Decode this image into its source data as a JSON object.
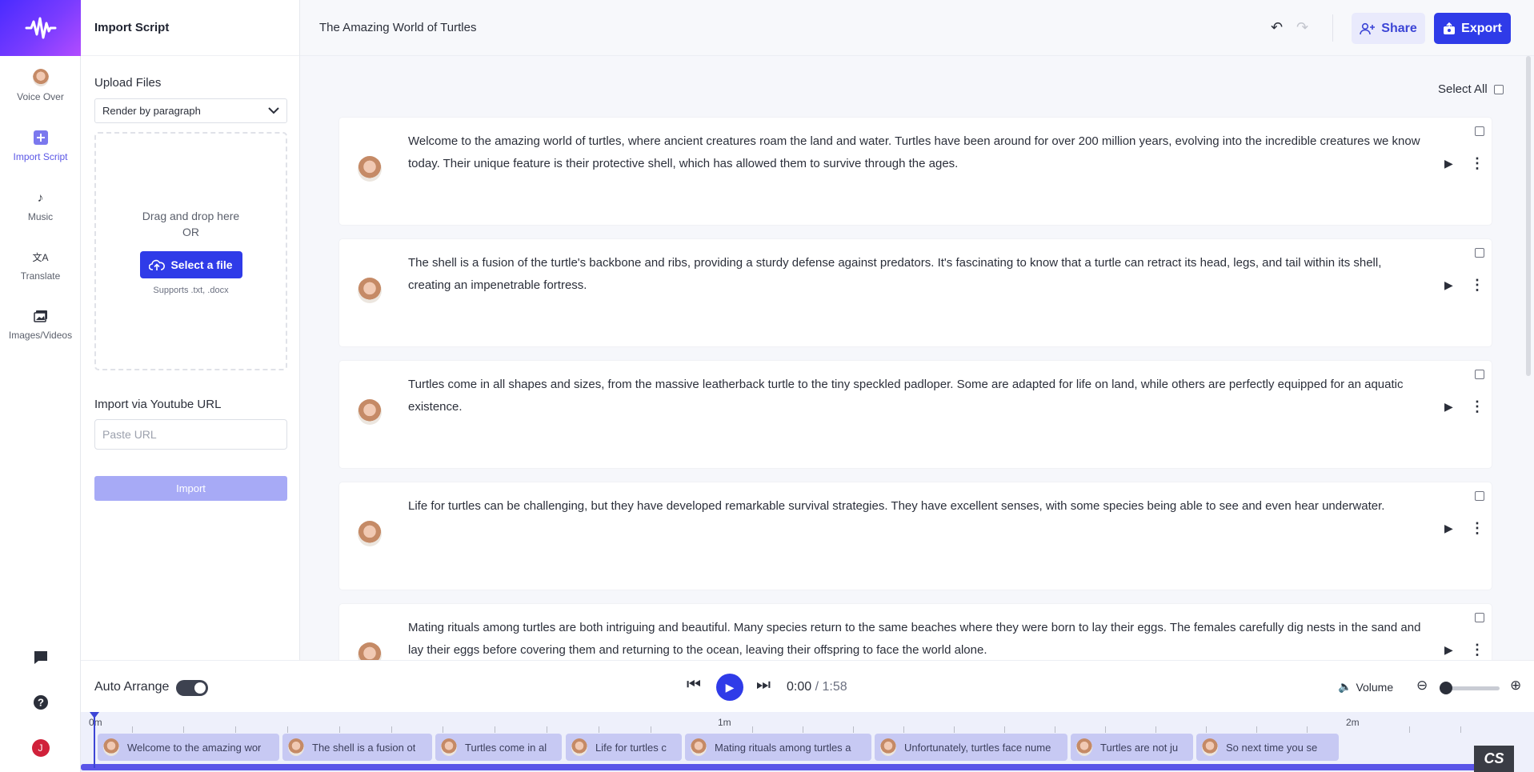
{
  "rail": {
    "items": [
      {
        "label": "Voice Over",
        "icon": "avatar-icon"
      },
      {
        "label": "Import Script",
        "icon": "plus-square-icon"
      },
      {
        "label": "Music",
        "icon": "music-note-icon"
      },
      {
        "label": "Translate",
        "icon": "translate-icon"
      },
      {
        "label": "Images/Videos",
        "icon": "images-icon"
      }
    ],
    "user_initial": "J"
  },
  "panel": {
    "title": "Import Script",
    "upload_label": "Upload Files",
    "render_mode": "Render by paragraph",
    "drag_text": "Drag and drop here",
    "or_text": "OR",
    "select_file": "Select a file",
    "supports": "Supports .txt, .docx",
    "youtube_label": "Import via Youtube URL",
    "url_placeholder": "Paste URL",
    "import_label": "Import"
  },
  "header": {
    "project_title": "The Amazing World of Turtles",
    "share_label": "Share",
    "export_label": "Export"
  },
  "main": {
    "select_all": "Select All",
    "paragraphs": [
      "Welcome to the amazing world of turtles, where ancient creatures roam the land and water. Turtles have been around for over 200 million years, evolving into the incredible creatures we know today. Their unique feature is their protective shell, which has allowed them to survive through the ages.",
      "The shell is a fusion of the turtle's backbone and ribs, providing a sturdy defense against predators. It's fascinating to know that a turtle can retract its head, legs, and tail within its shell, creating an impenetrable fortress.",
      "Turtles come in all shapes and sizes, from the massive leatherback turtle to the tiny speckled padloper. Some are adapted for life on land, while others are perfectly equipped for an aquatic existence.",
      "Life for turtles can be challenging, but they have developed remarkable survival strategies. They have excellent senses, with some species being able to see and even hear underwater.",
      "Mating rituals among turtles are both intriguing and beautiful. Many species return to the same beaches where they were born to lay their eggs. The females carefully dig nests in the sand and lay their eggs before covering them and returning to the ocean, leaving their offspring to face the world alone."
    ]
  },
  "player": {
    "auto_arrange": "Auto Arrange",
    "current": "0:00",
    "separator": " / ",
    "duration": "1:58",
    "volume_label": "Volume"
  },
  "timeline": {
    "ruler": [
      "0m",
      "1m",
      "2m"
    ],
    "clips": [
      "Welcome to the amazing wor",
      "The shell is a fusion ot",
      "Turtles come in al",
      "Life for turtles c",
      "Mating rituals among turtles a",
      "Unfortunately, turtles face nume",
      "Turtles are not ju",
      "So next time you se"
    ]
  },
  "badge": "CS",
  "colors": {
    "accent": "#2f3be8",
    "accent_soft": "#e9eafc",
    "clip": "#c7c9f3"
  }
}
